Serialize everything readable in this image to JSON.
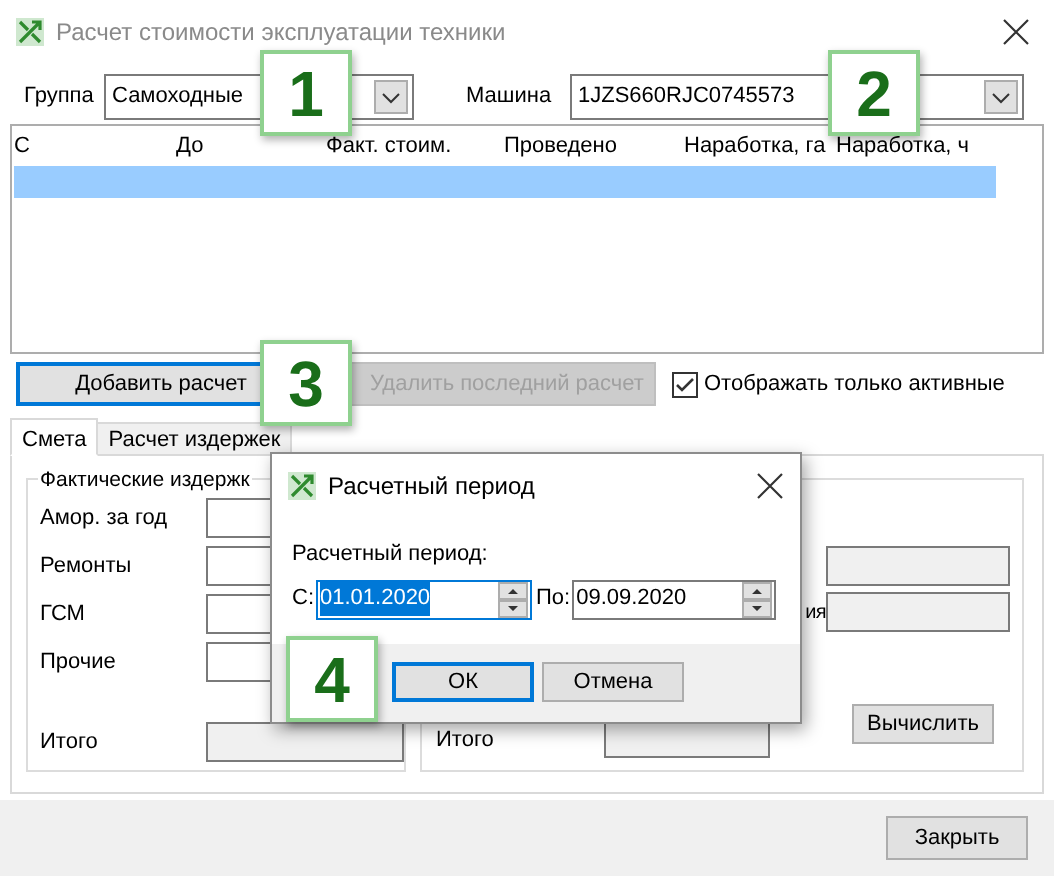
{
  "window": {
    "title": "Расчет стоимости эксплуатации техники"
  },
  "filters": [
    {
      "label": "Группа",
      "value": "Самоходные"
    },
    {
      "label": "Машина",
      "value": "1JZS660RJC0745573"
    }
  ],
  "table": {
    "columns": [
      "С",
      "До",
      "Факт. стоим.",
      "Проведено",
      "Наработка, га",
      "Наработка, ч"
    ],
    "rows": [
      {
        "selected": true
      }
    ]
  },
  "actions": [
    {
      "label": "Добавить расчет",
      "disabled": false,
      "focused": true
    },
    {
      "label": "Удалить последний расчет",
      "disabled": true,
      "focused": false
    }
  ],
  "active_only": {
    "label": "Отображать только активные",
    "checked": true
  },
  "tabs": [
    {
      "label": "Смета",
      "selected": true
    },
    {
      "label": "Расчет издержек",
      "selected": false
    }
  ],
  "actual_costs": {
    "title": "Фактические издержк",
    "fields": [
      {
        "label": "Амор. за год",
        "readonly": false
      },
      {
        "label": "Ремонты",
        "readonly": false
      },
      {
        "label": "ГСМ",
        "readonly": false
      },
      {
        "label": "Прочие",
        "readonly": false
      }
    ],
    "total_label": "Итого"
  },
  "right_group": {
    "partial_label": "ия",
    "total_label": "Итого",
    "compute_button": "Вычислить"
  },
  "close_button": "Закрыть",
  "dialog": {
    "title": "Расчетный период",
    "label": "Расчетный период:",
    "from": {
      "label": "С:",
      "value": "01.01.2020",
      "text_selected": true
    },
    "to": {
      "label": "По:",
      "value": "09.09.2020",
      "text_selected": false
    },
    "buttons": [
      {
        "label": "ОК",
        "focused": true
      },
      {
        "label": "Отмена",
        "focused": false
      }
    ]
  },
  "callouts": [
    "1",
    "2",
    "3",
    "4"
  ]
}
